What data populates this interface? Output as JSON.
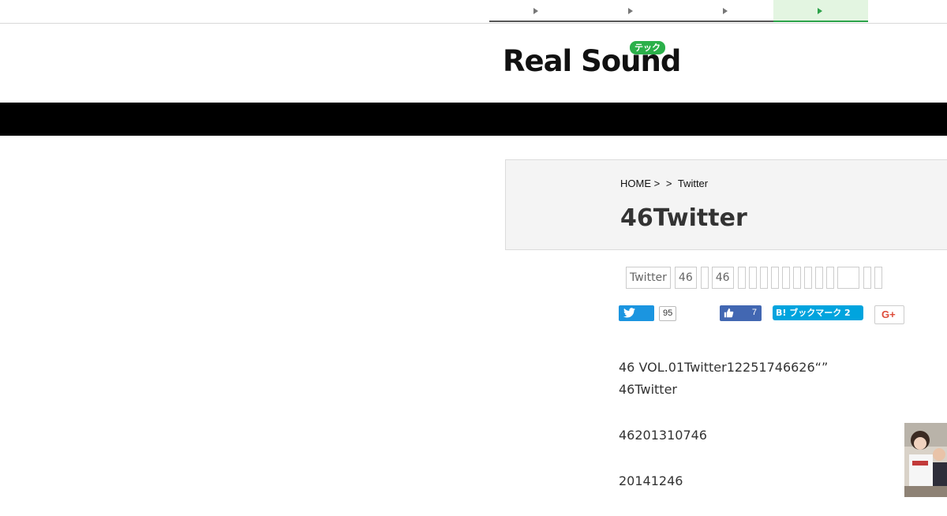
{
  "top_tabs": [
    {
      "label": ""
    },
    {
      "label": ""
    },
    {
      "label": ""
    },
    {
      "label": "",
      "active": true
    }
  ],
  "logo": {
    "text": "Real Sound",
    "badge": "テック"
  },
  "breadcrumb": {
    "home": "HOME >",
    "sep": ">",
    "current": "Twitter"
  },
  "title": "46Twitter",
  "tags": [
    "Twitter",
    "46",
    "",
    "46"
  ],
  "share": {
    "twitter_count": "95",
    "facebook_count": "7",
    "hatena_label": "B! ブックマーク 2",
    "gplus_label": "G+"
  },
  "article": {
    "lines": [
      "46 VOL.01Twitter12251746626“”",
      "46Twitter",
      "46201310746",
      "20141246"
    ]
  },
  "colors": {
    "accent_green": "#2ca24a",
    "twitter_blue": "#1b95e0",
    "facebook_blue": "#4267b2",
    "hatena_blue": "#00a4de",
    "nav_band": "#000000"
  }
}
